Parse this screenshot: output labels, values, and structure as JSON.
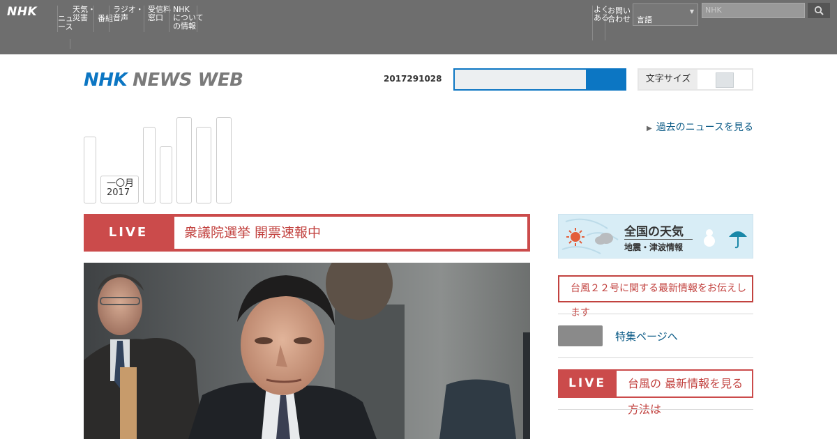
{
  "topbar": {
    "logo": "NHK",
    "nav_left": [
      {
        "label": "ニュ\nース"
      },
      {
        "label": "天気・\n災害"
      },
      {
        "label": "番組"
      },
      {
        "label": "ラジオ・\n音声"
      },
      {
        "label": "受信料\n窓口"
      },
      {
        "label": "NHK\nについて\nの情報"
      }
    ],
    "nav_right": [
      {
        "label": "よく\nある"
      },
      {
        "label": "お問い\n合わせ"
      }
    ],
    "language_select": "言語",
    "search_placeholder": "NHK"
  },
  "header": {
    "brand_nhk": "NHK",
    "brand_news": "NEWS WEB",
    "date_text": "2017291028",
    "toggle_label": "文字サイズ"
  },
  "date_nav": {
    "active_line1": "一〇月",
    "active_line2": "2017"
  },
  "more_link": "過去のニュースを見る",
  "live_main": {
    "tag": "LIVE",
    "title": "衆議院選挙 開票速報中"
  },
  "weather_banner": {
    "title": "全国の天気",
    "subtitle": "地震・津波情報"
  },
  "notice": "台風２２号に関する最新情報をお伝えします",
  "gray_link": "特集ページへ",
  "live_side": {
    "tag": "LIVE",
    "title": "台風の 最新情報を見る方法は"
  },
  "colors": {
    "brand_blue": "#0c76c3",
    "live_red": "#cb4b4b",
    "topbar_gray": "#6e6e6e"
  }
}
